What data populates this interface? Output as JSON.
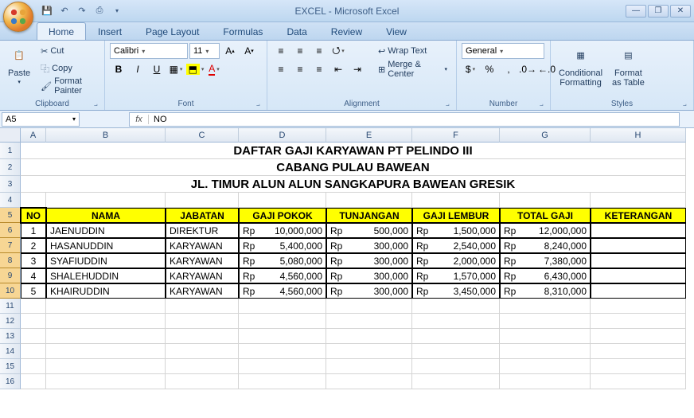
{
  "title": "EXCEL - Microsoft Excel",
  "tabs": [
    "Home",
    "Insert",
    "Page Layout",
    "Formulas",
    "Data",
    "Review",
    "View"
  ],
  "active_tab": "Home",
  "ribbon": {
    "clipboard": {
      "paste": "Paste",
      "cut": "Cut",
      "copy": "Copy",
      "format_painter": "Format Painter",
      "title": "Clipboard"
    },
    "font": {
      "name": "Calibri",
      "size": "11",
      "title": "Font"
    },
    "alignment": {
      "wrap": "Wrap Text",
      "merge": "Merge & Center",
      "title": "Alignment"
    },
    "number": {
      "format": "General",
      "title": "Number"
    },
    "styles": {
      "conditional": "Conditional\nFormatting",
      "format_table": "Format\nas Table",
      "title": "Styles"
    }
  },
  "name_box": "A5",
  "formula": "NO",
  "columns": [
    "A",
    "B",
    "C",
    "D",
    "E",
    "F",
    "G",
    "H"
  ],
  "title_rows": [
    "DAFTAR GAJI KARYAWAN PT PELINDO III",
    "CABANG PULAU BAWEAN",
    "JL. TIMUR ALUN ALUN SANGKAPURA BAWEAN GRESIK"
  ],
  "table": {
    "headers": [
      "NO",
      "NAMA",
      "JABATAN",
      "GAJI POKOK",
      "TUNJANGAN",
      "GAJI LEMBUR",
      "TOTAL GAJI",
      "KETERANGAN"
    ],
    "rows": [
      {
        "no": "1",
        "nama": "JAENUDDIN",
        "jabatan": "DIREKTUR",
        "pokok": "10,000,000",
        "tunj": "500,000",
        "lembur": "1,500,000",
        "total": "12,000,000",
        "ket": ""
      },
      {
        "no": "2",
        "nama": "HASANUDDIN",
        "jabatan": "KARYAWAN",
        "pokok": "5,400,000",
        "tunj": "300,000",
        "lembur": "2,540,000",
        "total": "8,240,000",
        "ket": ""
      },
      {
        "no": "3",
        "nama": "SYAFIUDDIN",
        "jabatan": "KARYAWAN",
        "pokok": "5,080,000",
        "tunj": "300,000",
        "lembur": "2,000,000",
        "total": "7,380,000",
        "ket": ""
      },
      {
        "no": "4",
        "nama": "SHALEHUDDIN",
        "jabatan": "KARYAWAN",
        "pokok": "4,560,000",
        "tunj": "300,000",
        "lembur": "1,570,000",
        "total": "6,430,000",
        "ket": ""
      },
      {
        "no": "5",
        "nama": "KHAIRUDDIN",
        "jabatan": "KARYAWAN",
        "pokok": "4,560,000",
        "tunj": "300,000",
        "lembur": "3,450,000",
        "total": "8,310,000",
        "ket": ""
      }
    ],
    "currency": "Rp"
  }
}
